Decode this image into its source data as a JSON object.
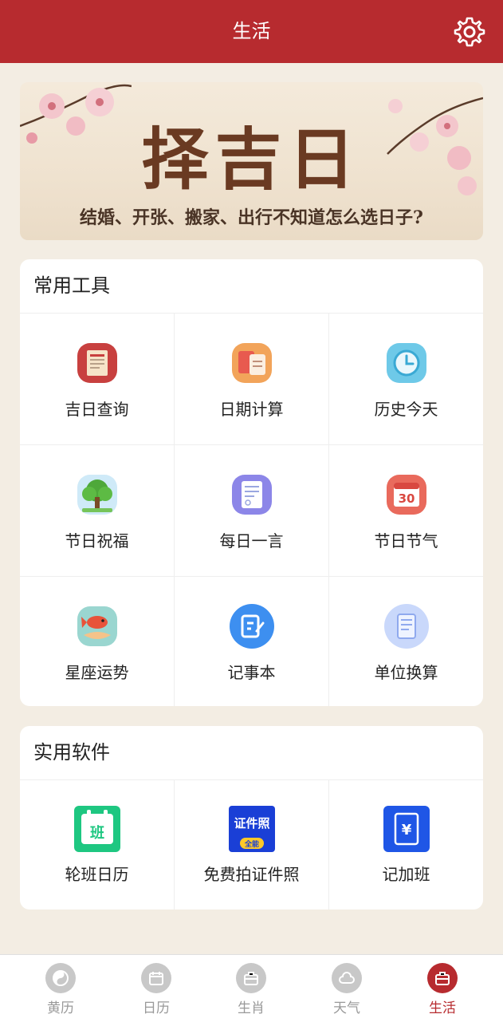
{
  "header": {
    "title": "生活"
  },
  "banner": {
    "title": "择吉日",
    "subtitle": "结婚、开张、搬家、出行不知道怎么选日子?"
  },
  "tools": {
    "title": "常用工具",
    "items": [
      {
        "label": "吉日查询",
        "icon": "almanac-book-icon"
      },
      {
        "label": "日期计算",
        "icon": "date-calc-icon"
      },
      {
        "label": "历史今天",
        "icon": "clock-icon"
      },
      {
        "label": "节日祝福",
        "icon": "tree-icon"
      },
      {
        "label": "每日一言",
        "icon": "note-card-icon"
      },
      {
        "label": "节日节气",
        "icon": "calendar-30-icon"
      },
      {
        "label": "星座运势",
        "icon": "koi-fish-icon"
      },
      {
        "label": "记事本",
        "icon": "notepad-icon"
      },
      {
        "label": "单位换算",
        "icon": "document-icon"
      }
    ]
  },
  "apps": {
    "title": "实用软件",
    "items": [
      {
        "label": "轮班日历",
        "icon_text": "班"
      },
      {
        "label": "免费拍证件照",
        "icon_text": "证件照",
        "icon_sub": "全能"
      },
      {
        "label": "记加班",
        "icon_text": "¥"
      }
    ]
  },
  "nav": {
    "items": [
      {
        "label": "黄历"
      },
      {
        "label": "日历"
      },
      {
        "label": "生肖"
      },
      {
        "label": "天气"
      },
      {
        "label": "生活"
      }
    ],
    "active_index": 4
  },
  "colors": {
    "primary": "#b72b2f",
    "background": "#f3ede3"
  }
}
